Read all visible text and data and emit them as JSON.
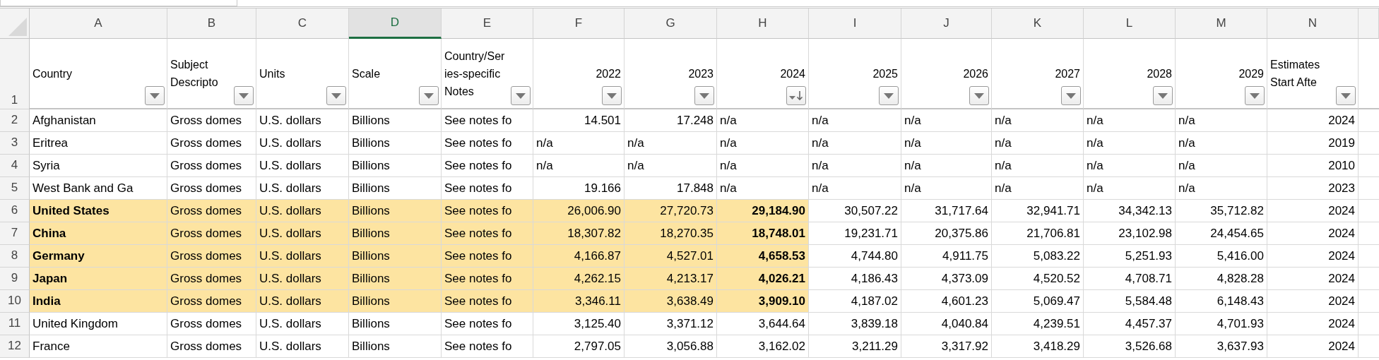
{
  "corner": {
    "kind": "select-all"
  },
  "columns": [
    {
      "letter": "A",
      "label": [
        "Country"
      ],
      "kind": "text",
      "filter": {
        "kind": "dropdown"
      },
      "selected": false
    },
    {
      "letter": "B",
      "label": [
        "Subject",
        "Descripto"
      ],
      "kind": "text",
      "filter": {
        "kind": "dropdown"
      },
      "selected": false
    },
    {
      "letter": "C",
      "label": [
        "Units"
      ],
      "kind": "text",
      "filter": {
        "kind": "dropdown"
      },
      "selected": false
    },
    {
      "letter": "D",
      "label": [
        "Scale"
      ],
      "kind": "text",
      "filter": {
        "kind": "dropdown"
      },
      "selected": true
    },
    {
      "letter": "E",
      "label": [
        "Country/Ser",
        "ies-specific",
        "Notes"
      ],
      "kind": "text",
      "filter": {
        "kind": "dropdown"
      },
      "selected": false
    },
    {
      "letter": "F",
      "label": [
        "2022"
      ],
      "kind": "year",
      "filter": {
        "kind": "dropdown"
      },
      "selected": false
    },
    {
      "letter": "G",
      "label": [
        "2023"
      ],
      "kind": "year",
      "filter": {
        "kind": "dropdown"
      },
      "selected": false
    },
    {
      "letter": "H",
      "label": [
        "2024"
      ],
      "kind": "year",
      "filter": {
        "kind": "sorted_descending"
      },
      "selected": false
    },
    {
      "letter": "I",
      "label": [
        "2025"
      ],
      "kind": "year",
      "filter": {
        "kind": "dropdown"
      },
      "selected": false
    },
    {
      "letter": "J",
      "label": [
        "2026"
      ],
      "kind": "year",
      "filter": {
        "kind": "dropdown"
      },
      "selected": false
    },
    {
      "letter": "K",
      "label": [
        "2027"
      ],
      "kind": "year",
      "filter": {
        "kind": "dropdown"
      },
      "selected": false
    },
    {
      "letter": "L",
      "label": [
        "2028"
      ],
      "kind": "year",
      "filter": {
        "kind": "dropdown"
      },
      "selected": false
    },
    {
      "letter": "M",
      "label": [
        "2029"
      ],
      "kind": "year",
      "filter": {
        "kind": "dropdown"
      },
      "selected": false
    },
    {
      "letter": "N",
      "label": [
        "Estimates",
        "Start Afte"
      ],
      "kind": "text",
      "filter": {
        "kind": "dropdown"
      },
      "selected": false
    }
  ],
  "header_row": {
    "number": "1"
  },
  "rows": [
    {
      "number": "2",
      "cells": [
        {
          "text": "Afghanistan",
          "kind": "text",
          "highlighted": false,
          "bold": false
        },
        {
          "text": "Gross domes",
          "kind": "text",
          "highlighted": false,
          "bold": false
        },
        {
          "text": "U.S. dollars",
          "kind": "text",
          "highlighted": false,
          "bold": false
        },
        {
          "text": "Billions",
          "kind": "text",
          "highlighted": false,
          "bold": false
        },
        {
          "text": "See notes fo",
          "kind": "text",
          "highlighted": false,
          "bold": false
        },
        {
          "text": "14.501",
          "kind": "number",
          "highlighted": false,
          "bold": false
        },
        {
          "text": "17.248",
          "kind": "number",
          "highlighted": false,
          "bold": false
        },
        {
          "text": "n/a",
          "kind": "text",
          "highlighted": false,
          "bold": false
        },
        {
          "text": "n/a",
          "kind": "text",
          "highlighted": false,
          "bold": false
        },
        {
          "text": "n/a",
          "kind": "text",
          "highlighted": false,
          "bold": false
        },
        {
          "text": "n/a",
          "kind": "text",
          "highlighted": false,
          "bold": false
        },
        {
          "text": "n/a",
          "kind": "text",
          "highlighted": false,
          "bold": false
        },
        {
          "text": "n/a",
          "kind": "text",
          "highlighted": false,
          "bold": false
        },
        {
          "text": "2024",
          "kind": "number",
          "highlighted": false,
          "bold": false
        }
      ]
    },
    {
      "number": "3",
      "cells": [
        {
          "text": "Eritrea",
          "kind": "text",
          "highlighted": false,
          "bold": false
        },
        {
          "text": "Gross domes",
          "kind": "text",
          "highlighted": false,
          "bold": false
        },
        {
          "text": "U.S. dollars",
          "kind": "text",
          "highlighted": false,
          "bold": false
        },
        {
          "text": "Billions",
          "kind": "text",
          "highlighted": false,
          "bold": false
        },
        {
          "text": "See notes fo",
          "kind": "text",
          "highlighted": false,
          "bold": false
        },
        {
          "text": "n/a",
          "kind": "text",
          "highlighted": false,
          "bold": false
        },
        {
          "text": "n/a",
          "kind": "text",
          "highlighted": false,
          "bold": false
        },
        {
          "text": "n/a",
          "kind": "text",
          "highlighted": false,
          "bold": false
        },
        {
          "text": "n/a",
          "kind": "text",
          "highlighted": false,
          "bold": false
        },
        {
          "text": "n/a",
          "kind": "text",
          "highlighted": false,
          "bold": false
        },
        {
          "text": "n/a",
          "kind": "text",
          "highlighted": false,
          "bold": false
        },
        {
          "text": "n/a",
          "kind": "text",
          "highlighted": false,
          "bold": false
        },
        {
          "text": "n/a",
          "kind": "text",
          "highlighted": false,
          "bold": false
        },
        {
          "text": "2019",
          "kind": "number",
          "highlighted": false,
          "bold": false
        }
      ]
    },
    {
      "number": "4",
      "cells": [
        {
          "text": "Syria",
          "kind": "text",
          "highlighted": false,
          "bold": false
        },
        {
          "text": "Gross domes",
          "kind": "text",
          "highlighted": false,
          "bold": false
        },
        {
          "text": "U.S. dollars",
          "kind": "text",
          "highlighted": false,
          "bold": false
        },
        {
          "text": "Billions",
          "kind": "text",
          "highlighted": false,
          "bold": false
        },
        {
          "text": "See notes fo",
          "kind": "text",
          "highlighted": false,
          "bold": false
        },
        {
          "text": "n/a",
          "kind": "text",
          "highlighted": false,
          "bold": false
        },
        {
          "text": "n/a",
          "kind": "text",
          "highlighted": false,
          "bold": false
        },
        {
          "text": "n/a",
          "kind": "text",
          "highlighted": false,
          "bold": false
        },
        {
          "text": "n/a",
          "kind": "text",
          "highlighted": false,
          "bold": false
        },
        {
          "text": "n/a",
          "kind": "text",
          "highlighted": false,
          "bold": false
        },
        {
          "text": "n/a",
          "kind": "text",
          "highlighted": false,
          "bold": false
        },
        {
          "text": "n/a",
          "kind": "text",
          "highlighted": false,
          "bold": false
        },
        {
          "text": "n/a",
          "kind": "text",
          "highlighted": false,
          "bold": false
        },
        {
          "text": "2010",
          "kind": "number",
          "highlighted": false,
          "bold": false
        }
      ]
    },
    {
      "number": "5",
      "cells": [
        {
          "text": "West Bank and Ga",
          "kind": "text",
          "highlighted": false,
          "bold": false
        },
        {
          "text": "Gross domes",
          "kind": "text",
          "highlighted": false,
          "bold": false
        },
        {
          "text": "U.S. dollars",
          "kind": "text",
          "highlighted": false,
          "bold": false
        },
        {
          "text": "Billions",
          "kind": "text",
          "highlighted": false,
          "bold": false
        },
        {
          "text": "See notes fo",
          "kind": "text",
          "highlighted": false,
          "bold": false
        },
        {
          "text": "19.166",
          "kind": "number",
          "highlighted": false,
          "bold": false
        },
        {
          "text": "17.848",
          "kind": "number",
          "highlighted": false,
          "bold": false
        },
        {
          "text": "n/a",
          "kind": "text",
          "highlighted": false,
          "bold": false
        },
        {
          "text": "n/a",
          "kind": "text",
          "highlighted": false,
          "bold": false
        },
        {
          "text": "n/a",
          "kind": "text",
          "highlighted": false,
          "bold": false
        },
        {
          "text": "n/a",
          "kind": "text",
          "highlighted": false,
          "bold": false
        },
        {
          "text": "n/a",
          "kind": "text",
          "highlighted": false,
          "bold": false
        },
        {
          "text": "n/a",
          "kind": "text",
          "highlighted": false,
          "bold": false
        },
        {
          "text": "2023",
          "kind": "number",
          "highlighted": false,
          "bold": false
        }
      ]
    },
    {
      "number": "6",
      "cells": [
        {
          "text": "United States",
          "kind": "text",
          "highlighted": true,
          "bold": true
        },
        {
          "text": "Gross domes",
          "kind": "text",
          "highlighted": true,
          "bold": false
        },
        {
          "text": "U.S. dollars",
          "kind": "text",
          "highlighted": true,
          "bold": false
        },
        {
          "text": "Billions",
          "kind": "text",
          "highlighted": true,
          "bold": false
        },
        {
          "text": "See notes fo",
          "kind": "text",
          "highlighted": true,
          "bold": false
        },
        {
          "text": "26,006.90",
          "kind": "number",
          "highlighted": true,
          "bold": false
        },
        {
          "text": "27,720.73",
          "kind": "number",
          "highlighted": true,
          "bold": false
        },
        {
          "text": "29,184.90",
          "kind": "number",
          "highlighted": true,
          "bold": true
        },
        {
          "text": "30,507.22",
          "kind": "number",
          "highlighted": false,
          "bold": false
        },
        {
          "text": "31,717.64",
          "kind": "number",
          "highlighted": false,
          "bold": false
        },
        {
          "text": "32,941.71",
          "kind": "number",
          "highlighted": false,
          "bold": false
        },
        {
          "text": "34,342.13",
          "kind": "number",
          "highlighted": false,
          "bold": false
        },
        {
          "text": "35,712.82",
          "kind": "number",
          "highlighted": false,
          "bold": false
        },
        {
          "text": "2024",
          "kind": "number",
          "highlighted": false,
          "bold": false
        }
      ]
    },
    {
      "number": "7",
      "cells": [
        {
          "text": "China",
          "kind": "text",
          "highlighted": true,
          "bold": true
        },
        {
          "text": "Gross domes",
          "kind": "text",
          "highlighted": true,
          "bold": false
        },
        {
          "text": "U.S. dollars",
          "kind": "text",
          "highlighted": true,
          "bold": false
        },
        {
          "text": "Billions",
          "kind": "text",
          "highlighted": true,
          "bold": false
        },
        {
          "text": "See notes fo",
          "kind": "text",
          "highlighted": true,
          "bold": false
        },
        {
          "text": "18,307.82",
          "kind": "number",
          "highlighted": true,
          "bold": false
        },
        {
          "text": "18,270.35",
          "kind": "number",
          "highlighted": true,
          "bold": false
        },
        {
          "text": "18,748.01",
          "kind": "number",
          "highlighted": true,
          "bold": true
        },
        {
          "text": "19,231.71",
          "kind": "number",
          "highlighted": false,
          "bold": false
        },
        {
          "text": "20,375.86",
          "kind": "number",
          "highlighted": false,
          "bold": false
        },
        {
          "text": "21,706.81",
          "kind": "number",
          "highlighted": false,
          "bold": false
        },
        {
          "text": "23,102.98",
          "kind": "number",
          "highlighted": false,
          "bold": false
        },
        {
          "text": "24,454.65",
          "kind": "number",
          "highlighted": false,
          "bold": false
        },
        {
          "text": "2024",
          "kind": "number",
          "highlighted": false,
          "bold": false
        }
      ]
    },
    {
      "number": "8",
      "cells": [
        {
          "text": "Germany",
          "kind": "text",
          "highlighted": true,
          "bold": true
        },
        {
          "text": "Gross domes",
          "kind": "text",
          "highlighted": true,
          "bold": false
        },
        {
          "text": "U.S. dollars",
          "kind": "text",
          "highlighted": true,
          "bold": false
        },
        {
          "text": "Billions",
          "kind": "text",
          "highlighted": true,
          "bold": false
        },
        {
          "text": "See notes fo",
          "kind": "text",
          "highlighted": true,
          "bold": false
        },
        {
          "text": "4,166.87",
          "kind": "number",
          "highlighted": true,
          "bold": false
        },
        {
          "text": "4,527.01",
          "kind": "number",
          "highlighted": true,
          "bold": false
        },
        {
          "text": "4,658.53",
          "kind": "number",
          "highlighted": true,
          "bold": true
        },
        {
          "text": "4,744.80",
          "kind": "number",
          "highlighted": false,
          "bold": false
        },
        {
          "text": "4,911.75",
          "kind": "number",
          "highlighted": false,
          "bold": false
        },
        {
          "text": "5,083.22",
          "kind": "number",
          "highlighted": false,
          "bold": false
        },
        {
          "text": "5,251.93",
          "kind": "number",
          "highlighted": false,
          "bold": false
        },
        {
          "text": "5,416.00",
          "kind": "number",
          "highlighted": false,
          "bold": false
        },
        {
          "text": "2024",
          "kind": "number",
          "highlighted": false,
          "bold": false
        }
      ]
    },
    {
      "number": "9",
      "cells": [
        {
          "text": "Japan",
          "kind": "text",
          "highlighted": true,
          "bold": true
        },
        {
          "text": "Gross domes",
          "kind": "text",
          "highlighted": true,
          "bold": false
        },
        {
          "text": "U.S. dollars",
          "kind": "text",
          "highlighted": true,
          "bold": false
        },
        {
          "text": "Billions",
          "kind": "text",
          "highlighted": true,
          "bold": false
        },
        {
          "text": "See notes fo",
          "kind": "text",
          "highlighted": true,
          "bold": false
        },
        {
          "text": "4,262.15",
          "kind": "number",
          "highlighted": true,
          "bold": false
        },
        {
          "text": "4,213.17",
          "kind": "number",
          "highlighted": true,
          "bold": false
        },
        {
          "text": "4,026.21",
          "kind": "number",
          "highlighted": true,
          "bold": true
        },
        {
          "text": "4,186.43",
          "kind": "number",
          "highlighted": false,
          "bold": false
        },
        {
          "text": "4,373.09",
          "kind": "number",
          "highlighted": false,
          "bold": false
        },
        {
          "text": "4,520.52",
          "kind": "number",
          "highlighted": false,
          "bold": false
        },
        {
          "text": "4,708.71",
          "kind": "number",
          "highlighted": false,
          "bold": false
        },
        {
          "text": "4,828.28",
          "kind": "number",
          "highlighted": false,
          "bold": false
        },
        {
          "text": "2024",
          "kind": "number",
          "highlighted": false,
          "bold": false
        }
      ]
    },
    {
      "number": "10",
      "cells": [
        {
          "text": "India",
          "kind": "text",
          "highlighted": true,
          "bold": true
        },
        {
          "text": "Gross domes",
          "kind": "text",
          "highlighted": true,
          "bold": false
        },
        {
          "text": "U.S. dollars",
          "kind": "text",
          "highlighted": true,
          "bold": false
        },
        {
          "text": "Billions",
          "kind": "text",
          "highlighted": true,
          "bold": false
        },
        {
          "text": "See notes fo",
          "kind": "text",
          "highlighted": true,
          "bold": false
        },
        {
          "text": "3,346.11",
          "kind": "number",
          "highlighted": true,
          "bold": false
        },
        {
          "text": "3,638.49",
          "kind": "number",
          "highlighted": true,
          "bold": false
        },
        {
          "text": "3,909.10",
          "kind": "number",
          "highlighted": true,
          "bold": true
        },
        {
          "text": "4,187.02",
          "kind": "number",
          "highlighted": false,
          "bold": false
        },
        {
          "text": "4,601.23",
          "kind": "number",
          "highlighted": false,
          "bold": false
        },
        {
          "text": "5,069.47",
          "kind": "number",
          "highlighted": false,
          "bold": false
        },
        {
          "text": "5,584.48",
          "kind": "number",
          "highlighted": false,
          "bold": false
        },
        {
          "text": "6,148.43",
          "kind": "number",
          "highlighted": false,
          "bold": false
        },
        {
          "text": "2024",
          "kind": "number",
          "highlighted": false,
          "bold": false
        }
      ]
    },
    {
      "number": "11",
      "cells": [
        {
          "text": "United Kingdom",
          "kind": "text",
          "highlighted": false,
          "bold": false
        },
        {
          "text": "Gross domes",
          "kind": "text",
          "highlighted": false,
          "bold": false
        },
        {
          "text": "U.S. dollars",
          "kind": "text",
          "highlighted": false,
          "bold": false
        },
        {
          "text": "Billions",
          "kind": "text",
          "highlighted": false,
          "bold": false
        },
        {
          "text": "See notes fo",
          "kind": "text",
          "highlighted": false,
          "bold": false
        },
        {
          "text": "3,125.40",
          "kind": "number",
          "highlighted": false,
          "bold": false
        },
        {
          "text": "3,371.12",
          "kind": "number",
          "highlighted": false,
          "bold": false
        },
        {
          "text": "3,644.64",
          "kind": "number",
          "highlighted": false,
          "bold": false
        },
        {
          "text": "3,839.18",
          "kind": "number",
          "highlighted": false,
          "bold": false
        },
        {
          "text": "4,040.84",
          "kind": "number",
          "highlighted": false,
          "bold": false
        },
        {
          "text": "4,239.51",
          "kind": "number",
          "highlighted": false,
          "bold": false
        },
        {
          "text": "4,457.37",
          "kind": "number",
          "highlighted": false,
          "bold": false
        },
        {
          "text": "4,701.93",
          "kind": "number",
          "highlighted": false,
          "bold": false
        },
        {
          "text": "2024",
          "kind": "number",
          "highlighted": false,
          "bold": false
        }
      ]
    },
    {
      "number": "12",
      "cells": [
        {
          "text": "France",
          "kind": "text",
          "highlighted": false,
          "bold": false
        },
        {
          "text": "Gross domes",
          "kind": "text",
          "highlighted": false,
          "bold": false
        },
        {
          "text": "U.S. dollars",
          "kind": "text",
          "highlighted": false,
          "bold": false
        },
        {
          "text": "Billions",
          "kind": "text",
          "highlighted": false,
          "bold": false
        },
        {
          "text": "See notes fo",
          "kind": "text",
          "highlighted": false,
          "bold": false
        },
        {
          "text": "2,797.05",
          "kind": "number",
          "highlighted": false,
          "bold": false
        },
        {
          "text": "3,056.88",
          "kind": "number",
          "highlighted": false,
          "bold": false
        },
        {
          "text": "3,162.02",
          "kind": "number",
          "highlighted": false,
          "bold": false
        },
        {
          "text": "3,211.29",
          "kind": "number",
          "highlighted": false,
          "bold": false
        },
        {
          "text": "3,317.92",
          "kind": "number",
          "highlighted": false,
          "bold": false
        },
        {
          "text": "3,418.29",
          "kind": "number",
          "highlighted": false,
          "bold": false
        },
        {
          "text": "3,526.68",
          "kind": "number",
          "highlighted": false,
          "bold": false
        },
        {
          "text": "3,637.93",
          "kind": "number",
          "highlighted": false,
          "bold": false
        },
        {
          "text": "2024",
          "kind": "number",
          "highlighted": false,
          "bold": false
        }
      ]
    }
  ]
}
